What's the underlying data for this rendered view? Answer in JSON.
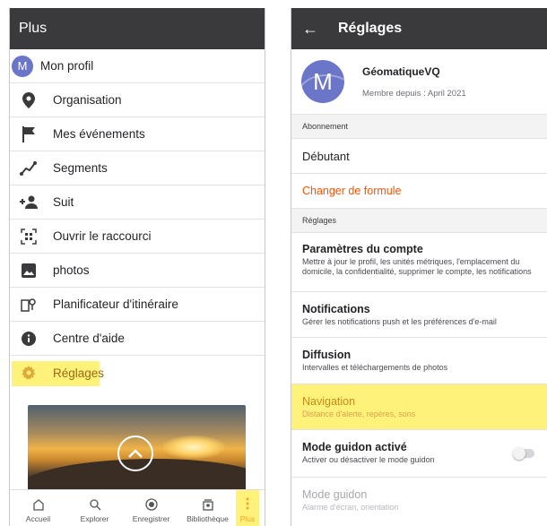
{
  "left": {
    "title": "Plus",
    "avatar_letter": "M",
    "menu": [
      {
        "label": "Mon profil",
        "icon": "avatar-icon"
      },
      {
        "label": "Organisation",
        "icon": "location-pin-icon"
      },
      {
        "label": "Mes événements",
        "icon": "flag-icon"
      },
      {
        "label": "Segments",
        "icon": "segment-icon"
      },
      {
        "label": "Suit",
        "icon": "add-person-icon"
      },
      {
        "label": "Ouvrir le raccourci",
        "icon": "qr-code-icon"
      },
      {
        "label": "photos",
        "icon": "photo-icon"
      },
      {
        "label": "Planificateur d'itinéraire",
        "icon": "route-icon"
      },
      {
        "label": "Centre d'aide",
        "icon": "info-icon"
      },
      {
        "label": "Réglages",
        "icon": "gear-icon"
      }
    ],
    "nav": [
      {
        "label": "Accueil",
        "icon": "home-icon"
      },
      {
        "label": "Explorer",
        "icon": "search-icon"
      },
      {
        "label": "Enregistrer",
        "icon": "record-icon"
      },
      {
        "label": "Bibliothèque",
        "icon": "library-icon"
      },
      {
        "label": "Plus",
        "icon": "more-icon"
      }
    ]
  },
  "right": {
    "title": "Réglages",
    "avatar_letter": "M",
    "profile_name": "GéomatiqueVQ",
    "member_since": "Membre depuis : April 2021",
    "section_subscription": "Abonnement",
    "level": "Débutant",
    "change_plan": "Changer de formule",
    "section_settings": "Réglages",
    "rows": [
      {
        "title": "Paramètres du compte",
        "sub": "Mettre à jour le profil, les unités métriques, l'emplacement du domicile, la confidentialité, supprimer le compte, les notifications"
      },
      {
        "title": "Notifications",
        "sub": "Gérer les notifications push et les préférences d'e-mail"
      },
      {
        "title": "Diffusion",
        "sub": "Intervalles et téléchargements de photos"
      },
      {
        "title": "Navigation",
        "sub": "Distance d'alerte, repères, sons"
      },
      {
        "title": "Mode guidon activé",
        "sub": "Activer ou désactiver le mode guidon"
      },
      {
        "title": "Mode guidon",
        "sub": "Alarme d'écran, orientation"
      }
    ],
    "toggle_on": false
  },
  "colors": {
    "appbar": "#3a3a3c",
    "highlight": "#fff27a",
    "accent": "#fc5200",
    "avatar": "#6b76c9"
  }
}
